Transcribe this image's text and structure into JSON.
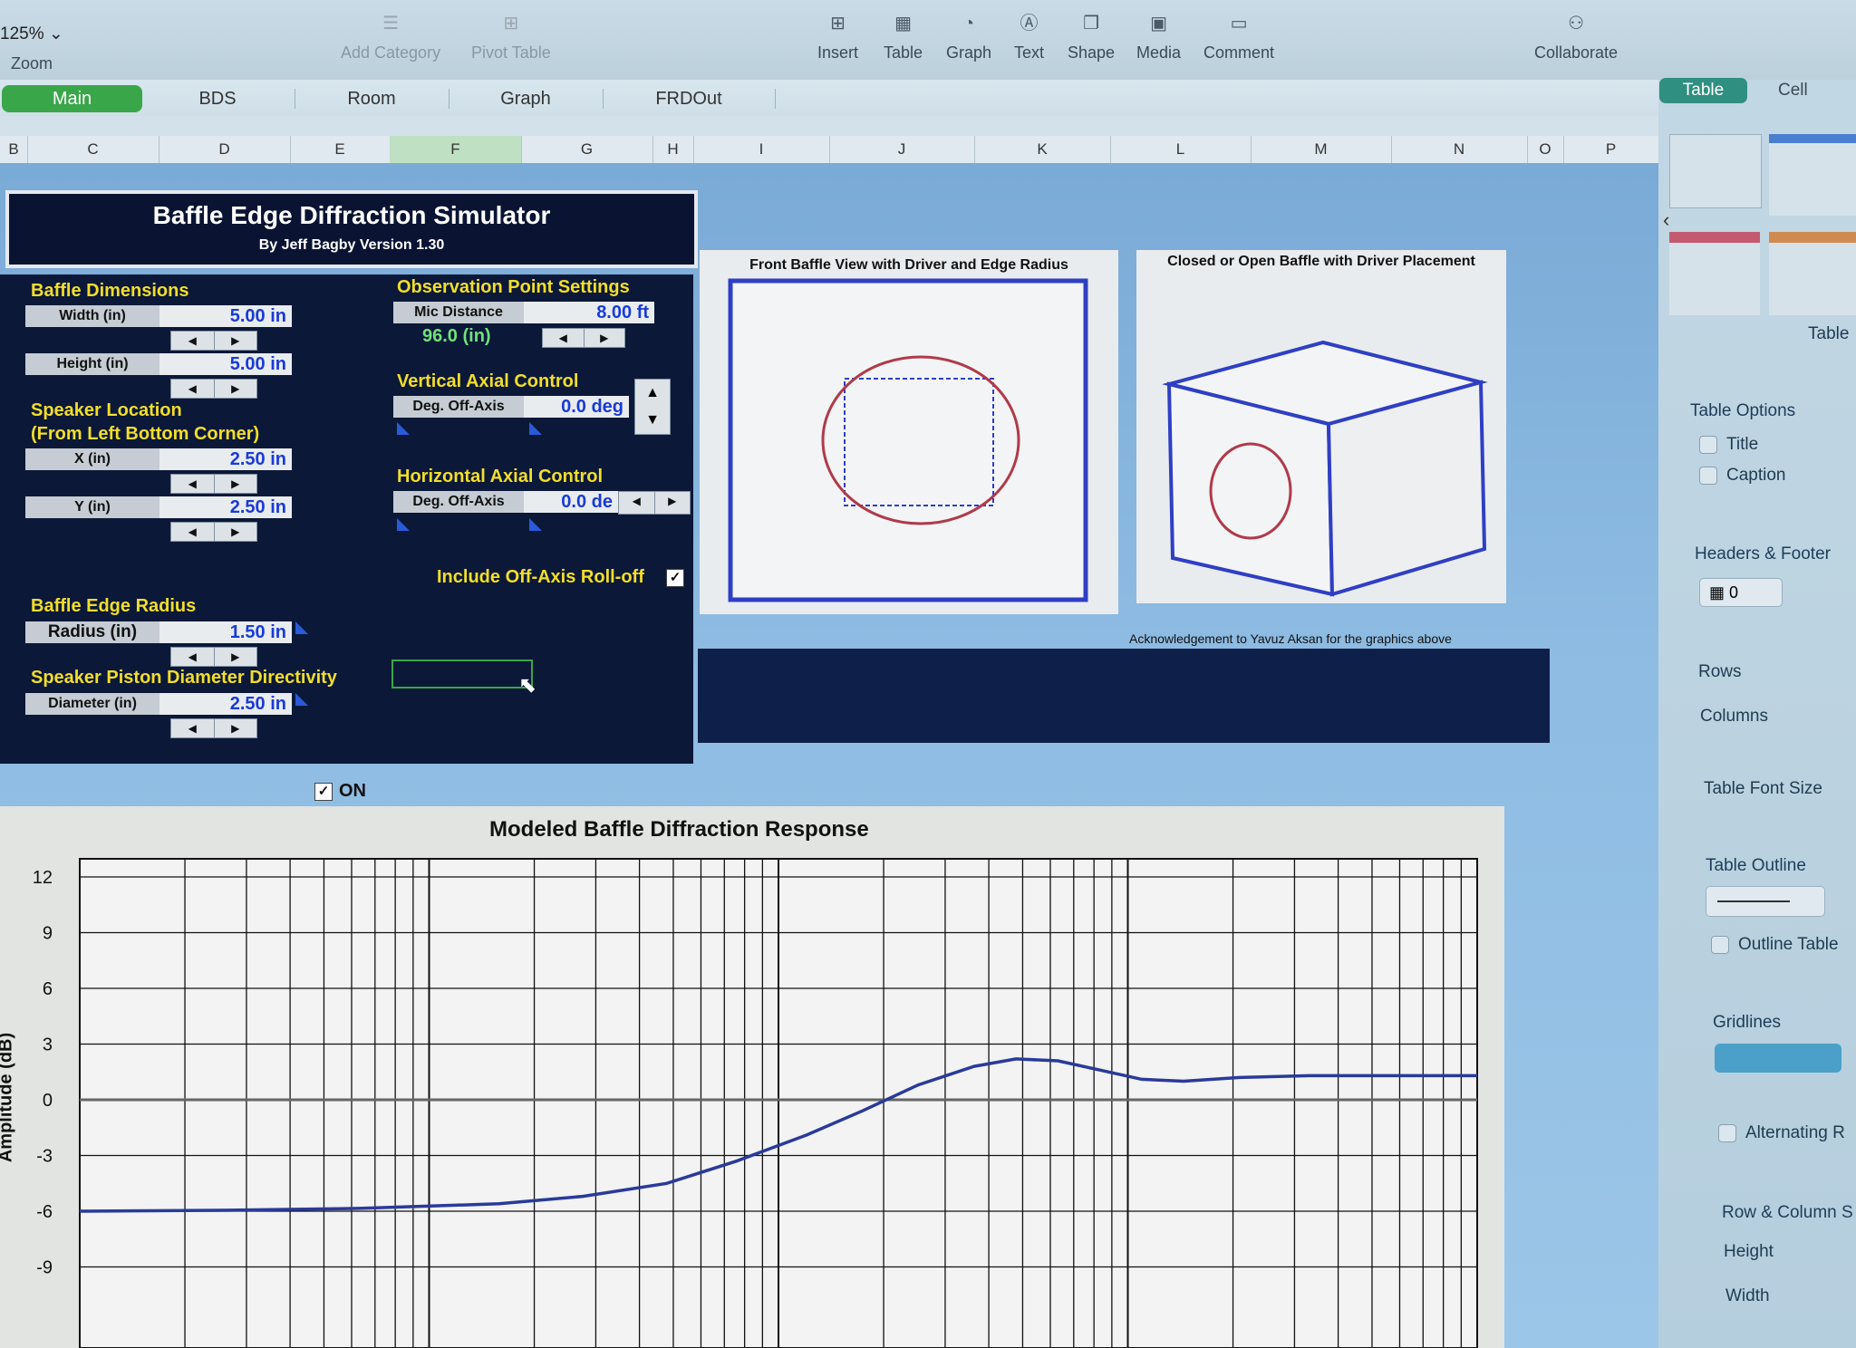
{
  "toolbar": {
    "zoom_value": "125%",
    "zoom_label": "Zoom",
    "add_category": "Add Category",
    "pivot_table": "Pivot Table",
    "insert": "Insert",
    "table": "Table",
    "graph": "Graph",
    "text": "Text",
    "shape": "Shape",
    "media": "Media",
    "comment": "Comment",
    "collaborate": "Collaborate"
  },
  "tabs": [
    "Main",
    "BDS",
    "Room",
    "Graph",
    "FRDOut"
  ],
  "inspector_tabs": {
    "table": "Table",
    "cell": "Cell"
  },
  "columns": [
    "B",
    "C",
    "D",
    "E",
    "F",
    "G",
    "H",
    "I",
    "J",
    "K",
    "L",
    "M",
    "N",
    "O",
    "P"
  ],
  "simulator": {
    "title": "Baffle Edge Diffraction Simulator",
    "subtitle": "By Jeff Bagby Version 1.30",
    "baffle_dimensions": "Baffle Dimensions",
    "width_label": "Width (in)",
    "width_value": "5.00 in",
    "height_label": "Height (in)",
    "height_value": "5.00 in",
    "speaker_location": "Speaker Location",
    "speaker_location_sub": "(From Left Bottom Corner)",
    "x_label": "X (in)",
    "x_value": "2.50 in",
    "y_label": "Y (in)",
    "y_value": "2.50 in",
    "edge_radius_title": "Baffle Edge Radius",
    "radius_label": "Radius (in)",
    "radius_value": "1.50 in",
    "piston_title": "Speaker Piston Diameter Directivity",
    "diameter_label": "Diameter (in)",
    "diameter_value": "2.50 in",
    "observation_title": "Observation Point Settings",
    "mic_label": "Mic Distance",
    "mic_value": "8.00 ft",
    "mic_inches": "96.0 (in)",
    "vertical_title": "Vertical Axial Control",
    "v_off_label": "Deg. Off-Axis",
    "v_off_value": "0.0 deg",
    "horizontal_title": "Horizontal Axial Control",
    "h_off_label": "Deg. Off-Axis",
    "h_off_value": "0.0 de",
    "rolloff_label": "Include Off-Axis Roll-off",
    "on_label": "ON"
  },
  "drawings": {
    "front_title": "Front Baffle View with Driver and Edge Radius",
    "box_title": "Closed or Open Baffle with Driver Placement",
    "acknowledgement": "Acknowledgement to Yavuz Aksan for the graphics above"
  },
  "inspector": {
    "table_label": "Table",
    "table_options": "Table Options",
    "title_opt": "Title",
    "caption_opt": "Caption",
    "headers_footer": "Headers & Footer",
    "header_count": "0",
    "rows": "Rows",
    "columns": "Columns",
    "font_size": "Table Font Size",
    "outline": "Table Outline",
    "outline_table": "Outline Table",
    "gridlines": "Gridlines",
    "alternating": "Alternating R",
    "row_col_size": "Row & Column S",
    "height": "Height",
    "width": "Width"
  },
  "chart_data": {
    "type": "line",
    "title": "Modeled Baffle Diffraction Response",
    "ylabel": "Amplitude (dB)",
    "xlabel": "",
    "x_scale": "log",
    "ylim": [
      -9,
      12
    ],
    "yticks": [
      "12",
      "9",
      "6",
      "3",
      "0",
      "-3",
      "-6",
      "-9"
    ],
    "grid": true,
    "series": [
      {
        "color": "#2a3a9a",
        "points": [
          [
            0.0,
            -6.0
          ],
          [
            0.1,
            -5.95
          ],
          [
            0.2,
            -5.85
          ],
          [
            0.3,
            -5.6
          ],
          [
            0.36,
            -5.2
          ],
          [
            0.42,
            -4.5
          ],
          [
            0.47,
            -3.3
          ],
          [
            0.52,
            -1.9
          ],
          [
            0.56,
            -0.6
          ],
          [
            0.6,
            0.8
          ],
          [
            0.64,
            1.8
          ],
          [
            0.67,
            2.2
          ],
          [
            0.7,
            2.1
          ],
          [
            0.73,
            1.6
          ],
          [
            0.76,
            1.1
          ],
          [
            0.79,
            1.0
          ],
          [
            0.83,
            1.2
          ],
          [
            0.88,
            1.3
          ],
          [
            0.94,
            1.3
          ],
          [
            1.0,
            1.3
          ]
        ]
      }
    ]
  }
}
